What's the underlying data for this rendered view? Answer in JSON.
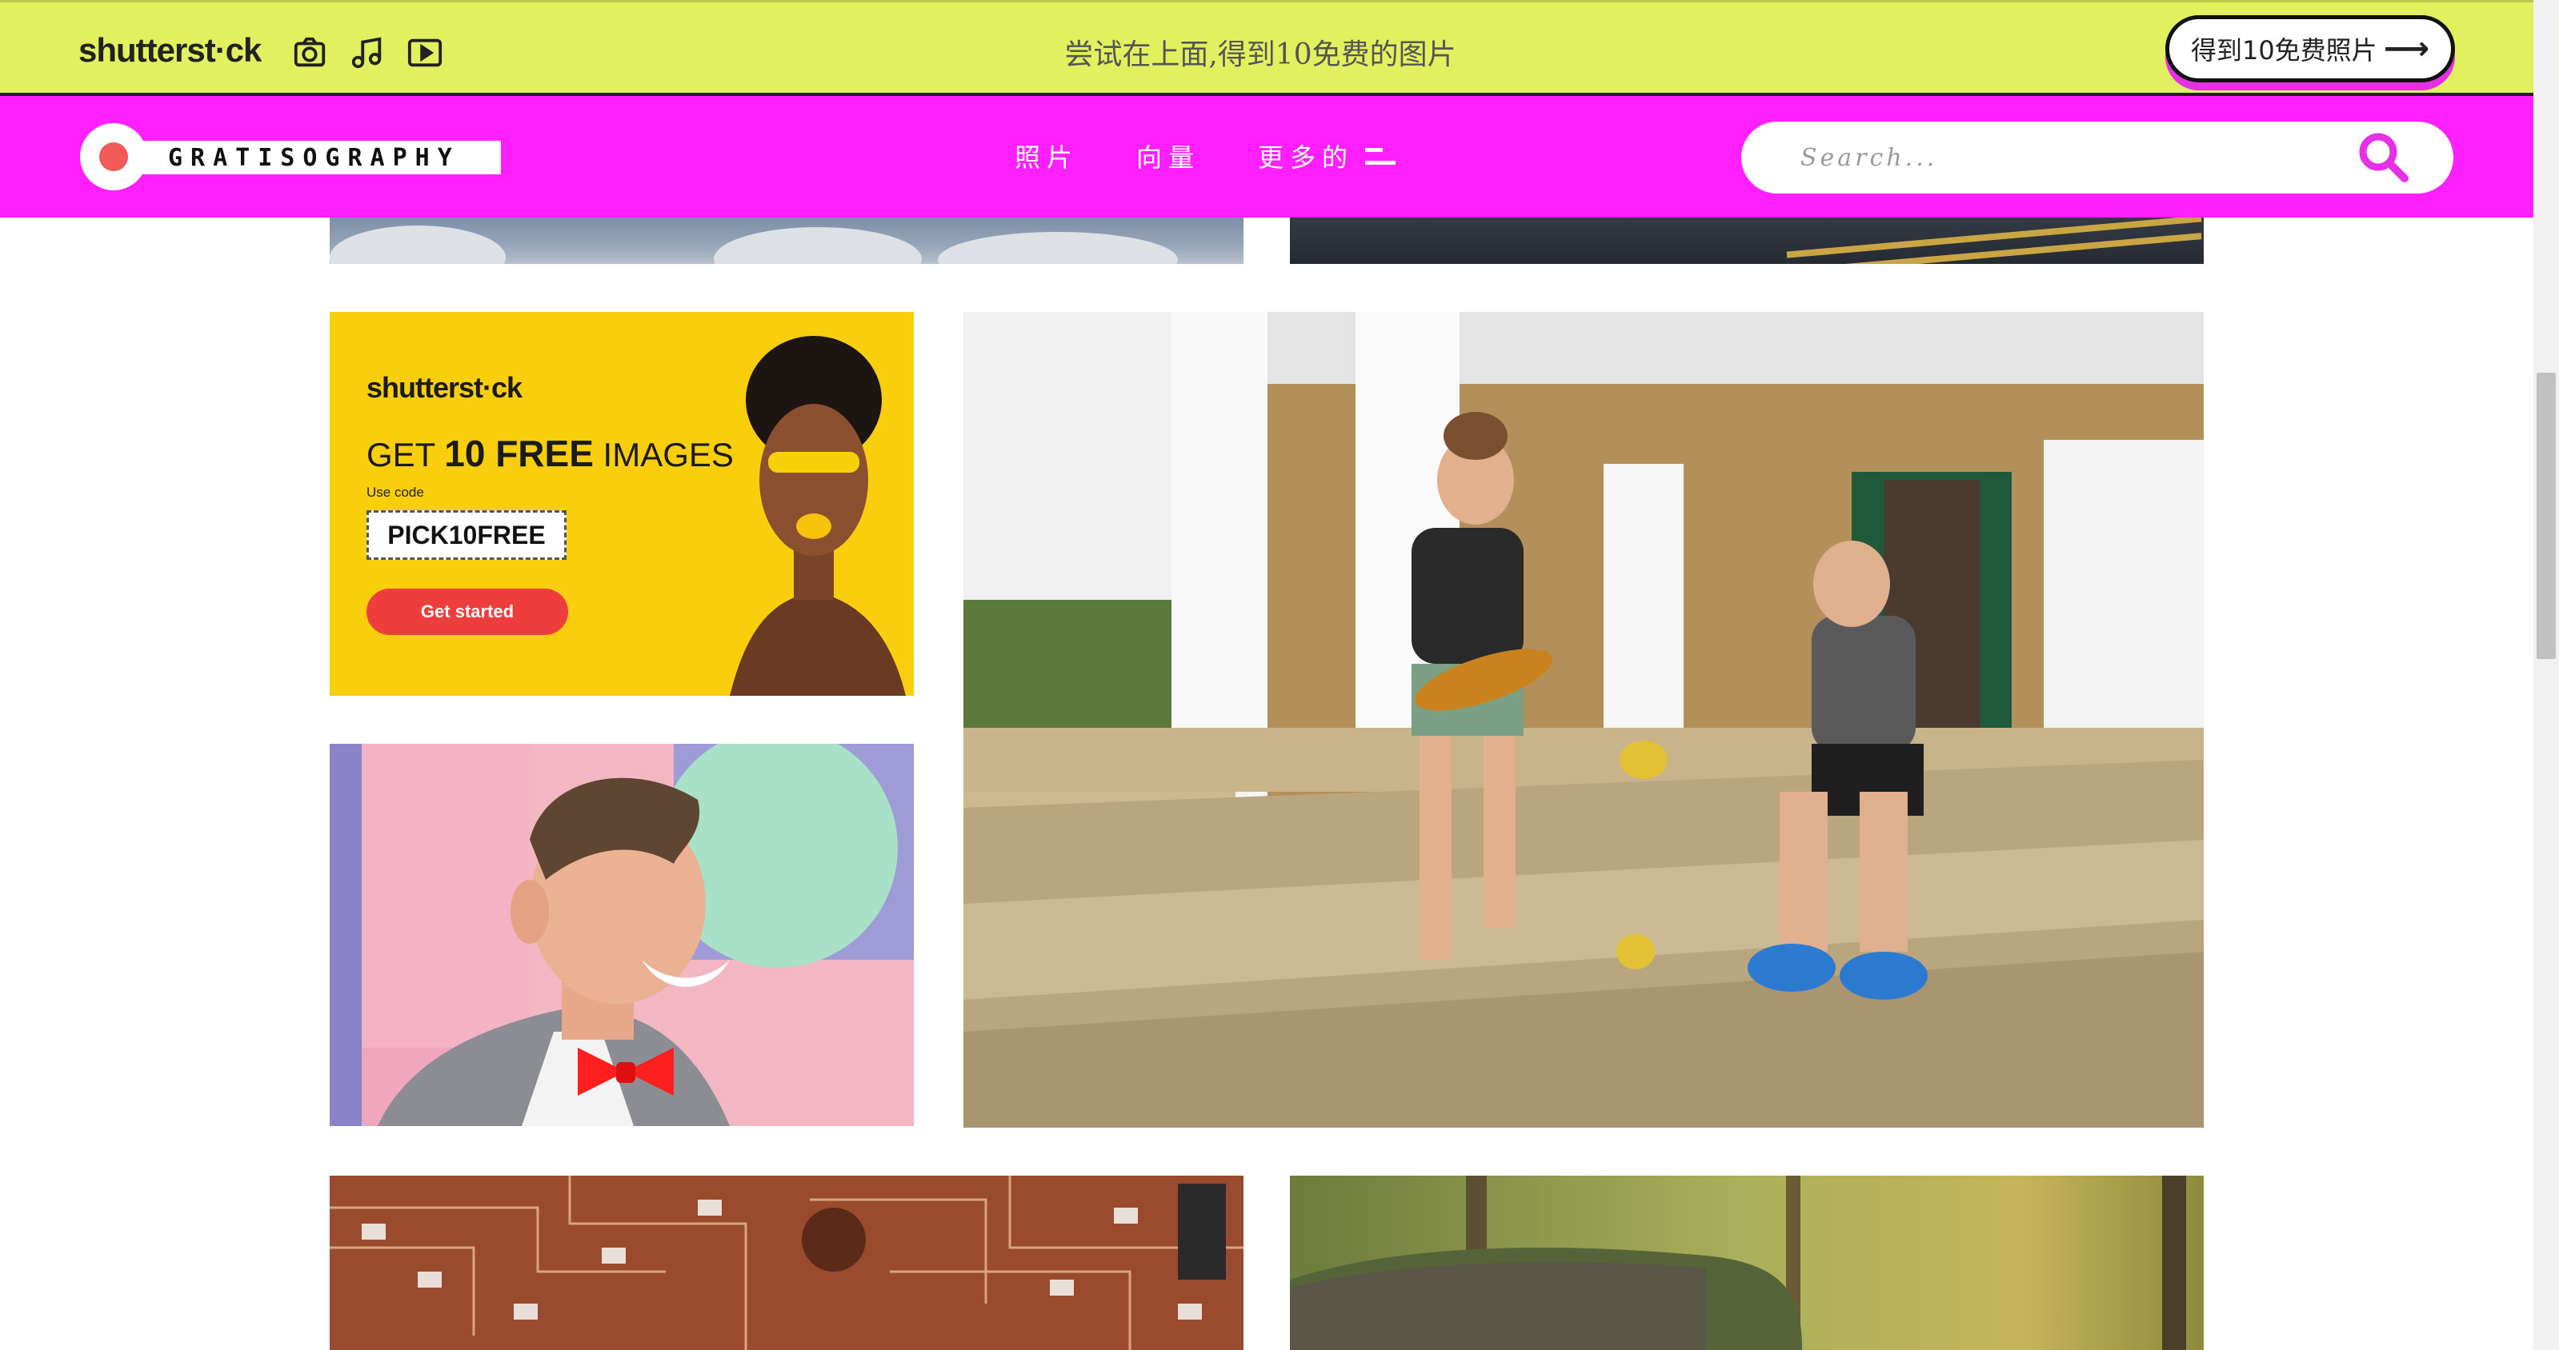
{
  "promo_bar": {
    "logo_text": "shutterst·ck",
    "icons": [
      "camera-icon",
      "music-icon",
      "video-icon"
    ],
    "message": "尝试在上面,得到10免费的图片",
    "cta_label": "得到10免费照片",
    "cta_arrow": "⟶"
  },
  "nav": {
    "logo_text": "GRATISOGRAPHY",
    "links": [
      {
        "label": "照片"
      },
      {
        "label": "向量"
      },
      {
        "label": "更多的"
      }
    ],
    "search_placeholder": "Search..."
  },
  "ad": {
    "logo_text": "shutterst·ck",
    "headline_prefix": "GET ",
    "headline_bold": "10 FREE",
    "headline_suffix": " IMAGES",
    "code_label": "Use code",
    "code": "PICK10FREE",
    "button_label": "Get started"
  },
  "colors": {
    "promo_bg": "#e1f05f",
    "nav_bg": "#ff1fff",
    "ad_bg": "#f9ce0c",
    "accent": "#e530e5",
    "ad_button": "#ee3d3d"
  }
}
